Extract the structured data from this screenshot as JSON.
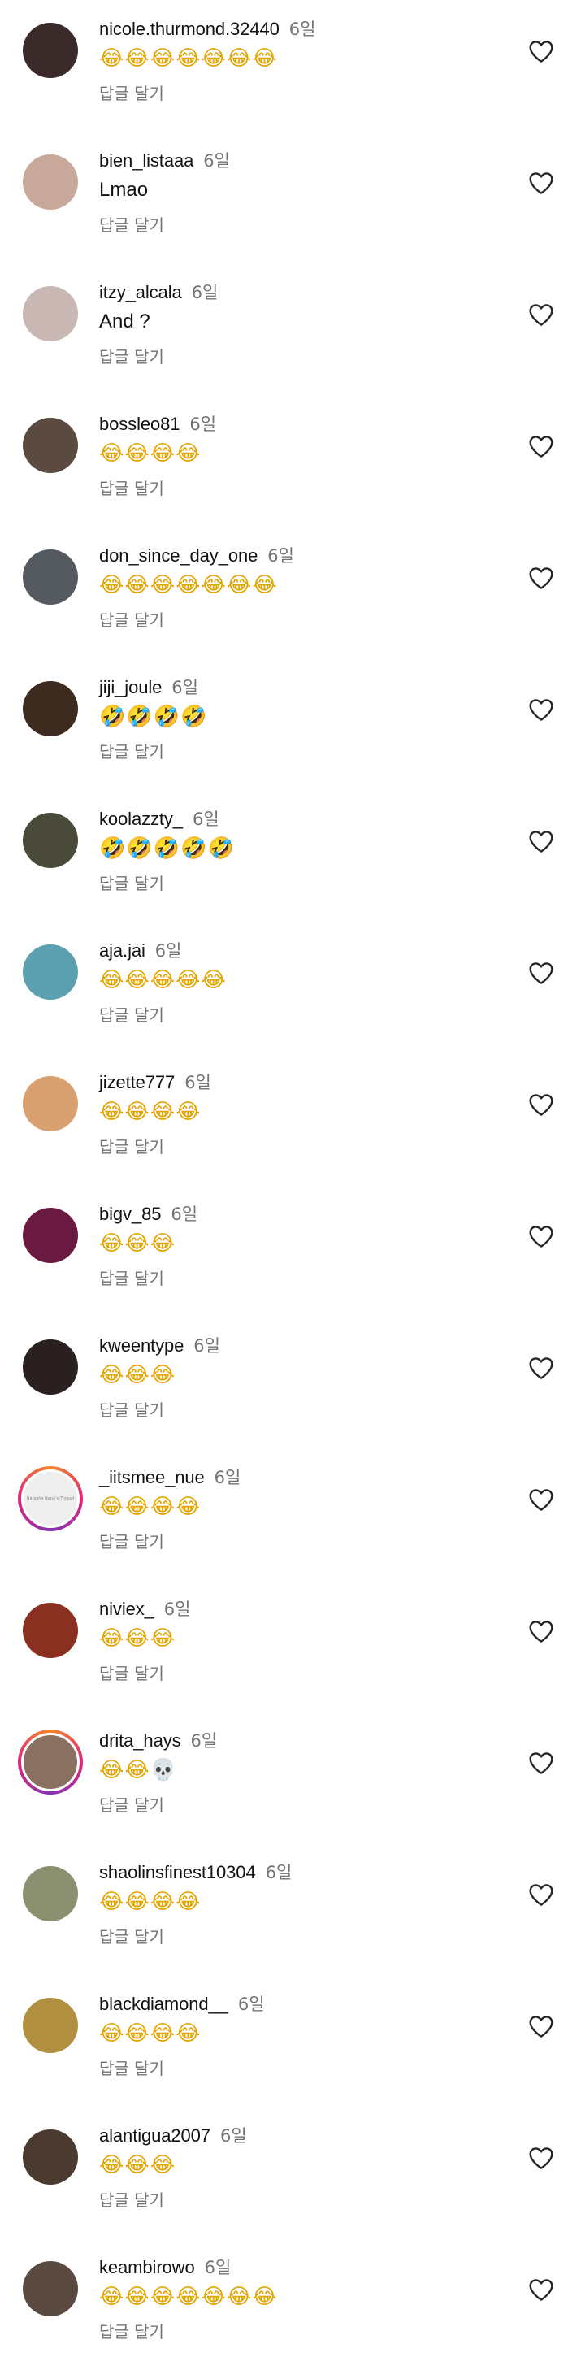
{
  "reply_label": "답글 달기",
  "comments": [
    {
      "username": "nicole.thurmond.32440",
      "time": "6일",
      "text": "😂😂😂😂😂😂😂",
      "avatar_color": "#3a2a2a"
    },
    {
      "username": "bien_listaaa",
      "time": "6일",
      "text": "Lmao",
      "avatar_color": "#c7a89a"
    },
    {
      "username": "itzy_alcala",
      "time": "6일",
      "text": "And ?",
      "avatar_color": "#c9b7b3"
    },
    {
      "username": "bossleo81",
      "time": "6일",
      "text": "😂😂😂😂",
      "avatar_color": "#5a4a40"
    },
    {
      "username": "don_since_day_one",
      "time": "6일",
      "text": "😂😂😂😂😂😂😂",
      "avatar_color": "#555a60"
    },
    {
      "username": "jiji_joule",
      "time": "6일",
      "text": "🤣🤣🤣🤣",
      "avatar_color": "#3d2b20"
    },
    {
      "username": "koolazzty_",
      "time": "6일",
      "text": "🤣🤣🤣🤣🤣",
      "avatar_color": "#4a4a3a"
    },
    {
      "username": "aja.jai",
      "time": "6일",
      "text": "😂😂😂😂😂",
      "avatar_color": "#5aa0b0"
    },
    {
      "username": "jizette777",
      "time": "6일",
      "text": "😂😂😂😂",
      "avatar_color": "#d9a070"
    },
    {
      "username": "bigv_85",
      "time": "6일",
      "text": "😂😂😂",
      "avatar_color": "#6a1a40"
    },
    {
      "username": "kweentype",
      "time": "6일",
      "text": "😂😂😂",
      "avatar_color": "#2a2020"
    },
    {
      "username": "_iitsmee_nue",
      "time": "6일",
      "text": "😂😂😂😂",
      "avatar_ring": true,
      "avatar_text": "Natasha Nang's Thread",
      "avatar_color": "#eeeeee"
    },
    {
      "username": "niviex_",
      "time": "6일",
      "text": "😂😂😂",
      "avatar_color": "#8a3020"
    },
    {
      "username": "drita_hays",
      "time": "6일",
      "text": "😂😂💀",
      "avatar_ring": true,
      "avatar_color": "#8a7060"
    },
    {
      "username": "shaolinsfinest10304",
      "time": "6일",
      "text": "😂😂😂😂",
      "avatar_color": "#8a9070"
    },
    {
      "username": "blackdiamond__",
      "time": "6일",
      "text": "😂😂😂😂",
      "avatar_color": "#b09040"
    },
    {
      "username": "alantigua2007",
      "time": "6일",
      "text": "😂😂😂",
      "avatar_color": "#4a3a30"
    },
    {
      "username": "keambirowo",
      "time": "6일",
      "text": "😂😂😂😂😂😂😂",
      "avatar_color": "#5a4a40"
    }
  ]
}
